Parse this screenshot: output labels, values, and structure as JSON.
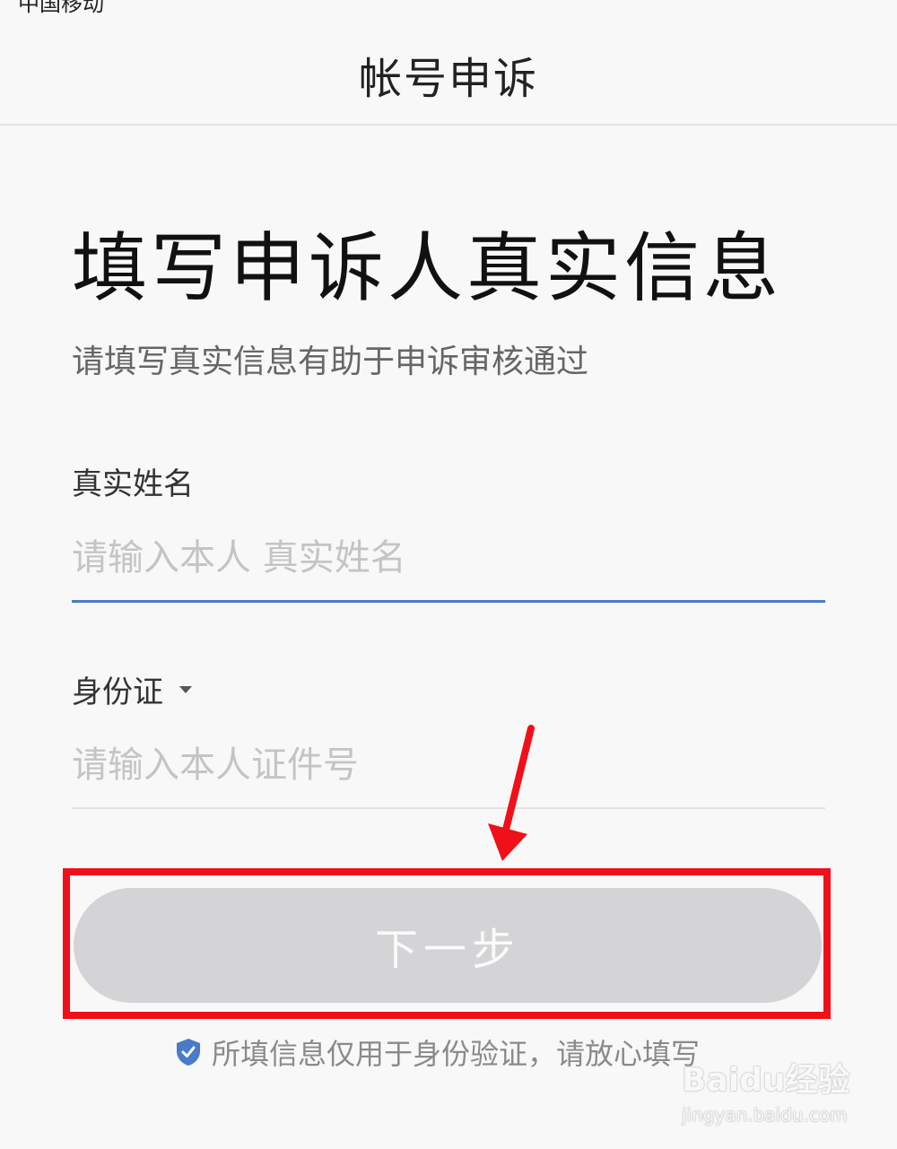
{
  "status_bar": {
    "carrier": "中国移动"
  },
  "header": {
    "title": "帐号申诉"
  },
  "main": {
    "heading": "填写申诉人真实信息",
    "subheading": "请填写真实信息有助于申诉审核通过",
    "name_field": {
      "label": "真实姓名",
      "placeholder": "请输入本人 真实姓名",
      "value": ""
    },
    "id_field": {
      "type_label": "身份证",
      "placeholder": "请输入本人证件号",
      "value": ""
    },
    "next_button": {
      "label": "下一步",
      "enabled": false
    },
    "notice": "所填信息仅用于身份验证，请放心填写"
  },
  "watermark": {
    "logo": "Baidu经验",
    "url": "jingyan.baidu.com"
  },
  "colors": {
    "accent": "#4a7bc6",
    "button_disabled": "#d4d4d6",
    "annotation": "#f0101a",
    "shield": "#4a7bc6"
  },
  "icons": [
    "dropdown-caret-icon",
    "shield-check-icon",
    "annotation-arrow"
  ]
}
